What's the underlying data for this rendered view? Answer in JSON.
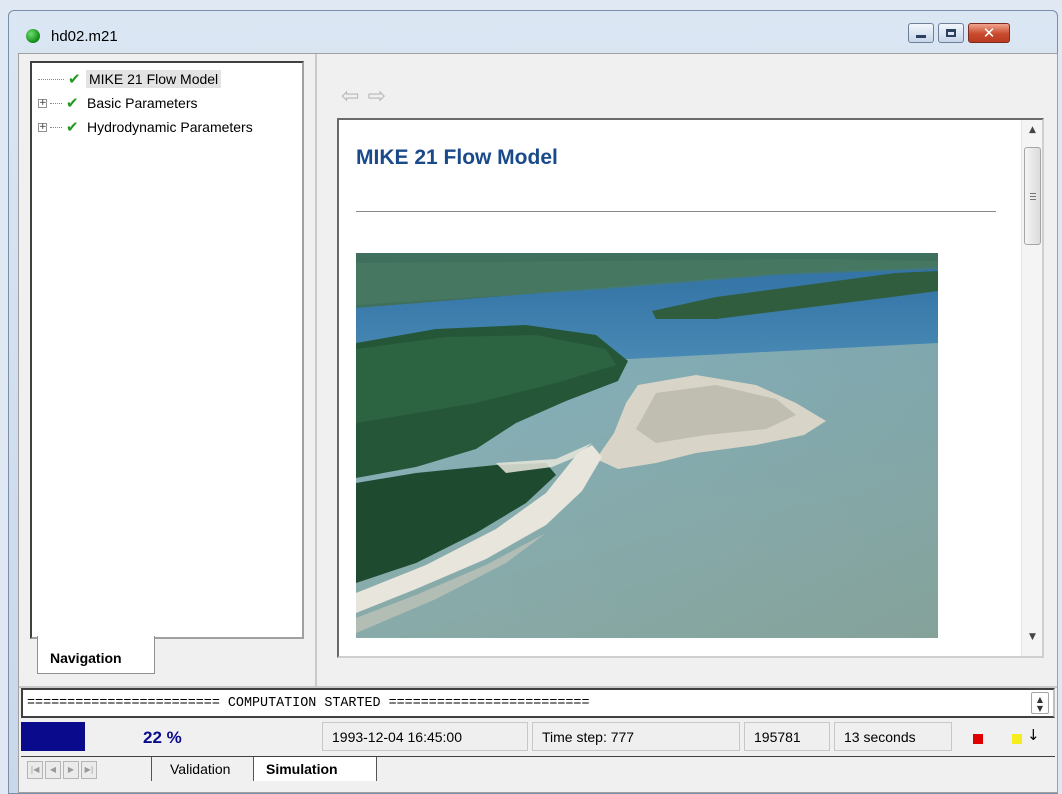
{
  "window": {
    "title": "hd02.m21"
  },
  "navigation": {
    "tree": [
      {
        "label": "MIKE 21 Flow Model",
        "checked": true,
        "expandable": false,
        "selected": true
      },
      {
        "label": "Basic Parameters",
        "checked": true,
        "expandable": true,
        "selected": false
      },
      {
        "label": "Hydrodynamic Parameters",
        "checked": true,
        "expandable": true,
        "selected": false
      }
    ],
    "tab_label": "Navigation"
  },
  "content": {
    "title": "MIKE 21 Flow Model",
    "image": "aerial-coastal-estuary-photo"
  },
  "log": {
    "line": "======================== COMPUTATION STARTED ========================="
  },
  "status": {
    "progress_percent": 22,
    "progress_text": "22 %",
    "datetime": "1993-12-04 16:45:00",
    "time_step": "Time step: 777",
    "count": "195781",
    "elapsed": "13 seconds",
    "indicator_colors": {
      "red": "#e00000",
      "yellow": "#f6ee1c"
    }
  },
  "tabs": [
    {
      "label": "Validation",
      "active": false
    },
    {
      "label": "Simulation",
      "active": true
    }
  ],
  "colors": {
    "accent": "#1a4a8a",
    "progress": "#0a0a8c"
  }
}
